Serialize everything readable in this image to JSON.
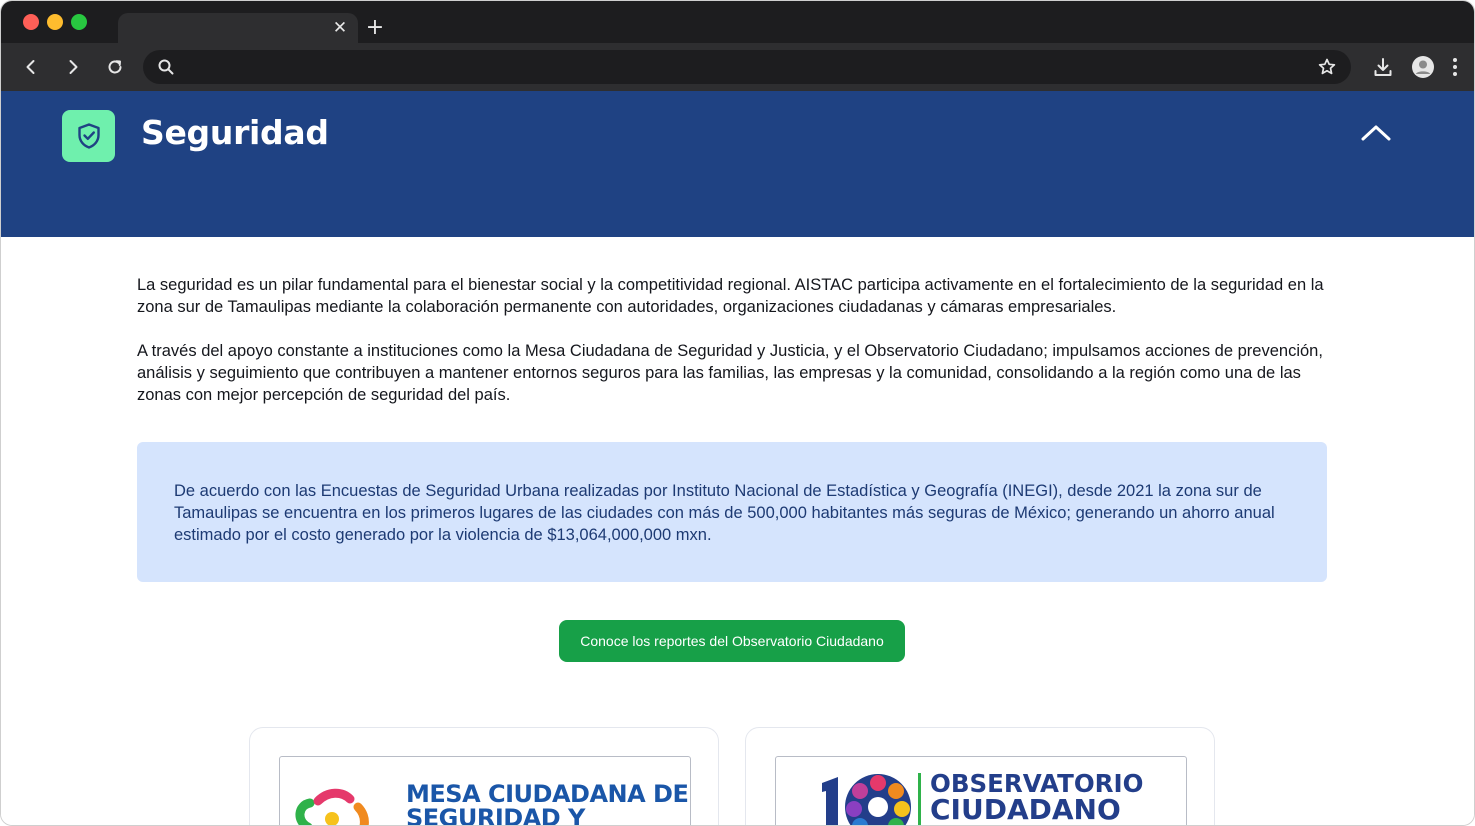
{
  "browser": {
    "tab_close_glyph": "✕",
    "new_tab_glyph": "+",
    "url": "",
    "icons": [
      "back-icon",
      "forward-icon",
      "reload-icon",
      "search-icon",
      "star-icon",
      "download-icon",
      "profile-icon",
      "menu-icon"
    ],
    "traffic_lights": [
      "#ff5f57",
      "#febc2e",
      "#28c840"
    ]
  },
  "hero": {
    "title": "Seguridad",
    "icon": "shield-check-icon",
    "toggle_icon": "chevron-up-icon",
    "background": "#1f4283",
    "icon_bg": "#6ff0ad"
  },
  "content": {
    "paragraph_1": "La seguridad es un pilar fundamental para el bienestar social y la competitividad regional. AISTAC participa activamente en el fortalecimiento de la seguridad en la zona sur de Tamaulipas mediante la colaboración permanente con autoridades, organizaciones ciudadanas y cámaras empresariales.",
    "paragraph_2": "A través del apoyo constante a instituciones como la Mesa Ciudadana de Seguridad y Justicia, y el Observatorio Ciudadano; impulsamos acciones de prevención, análisis y seguimiento que contribuyen a mantener entornos seguros para las familias, las empresas y la comunidad, consolidando a la región como una de las zonas con mejor percepción de seguridad del país."
  },
  "callout": {
    "text": "De acuerdo con las Encuestas de Seguridad Urbana realizadas por Instituto Nacional de Estadística y Geografía (INEGI), desde 2021 la zona sur de Tamaulipas se encuentra en los primeros lugares de las ciudades con más de 500,000 habitantes más seguras de México; generando un ahorro anual estimado por el costo generado por la violencia de $13,064,000,000 mxn.",
    "background": "#d5e4fd"
  },
  "cta": {
    "label": "Conoce los reportes del Observatorio Ciudadano",
    "color": "#17a048"
  },
  "cards": [
    {
      "logo_line_1": "MESA CIUDADANA DE",
      "logo_line_2": "SEGURIDAD Y JUSTICIA"
    },
    {
      "logo_line_1": "OBSERVATORIO",
      "logo_line_2": "CIUDADANO"
    }
  ]
}
